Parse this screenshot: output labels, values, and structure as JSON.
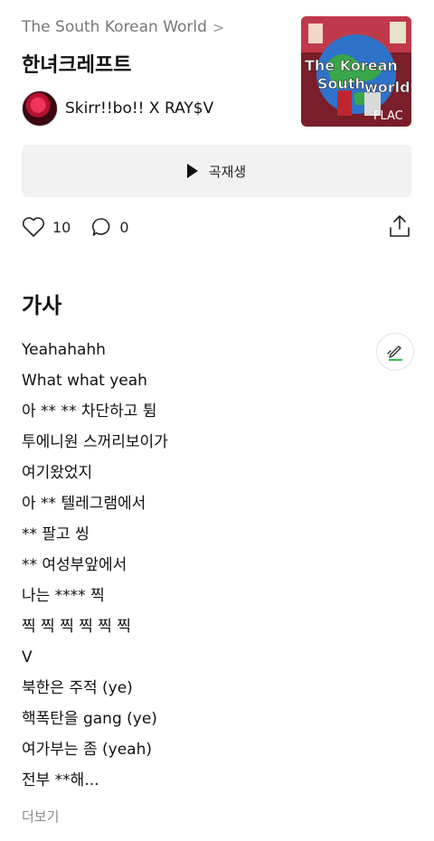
{
  "album": {
    "link_label": "The South Korean World",
    "chevron": ">"
  },
  "song": {
    "title": "한녀크레프트"
  },
  "artist": {
    "name": "Skirr!!bo!! X RAY$V"
  },
  "cover": {
    "title_line1": "The Korean",
    "title_line2": "South",
    "title_line3": "world",
    "badge": "FLAC"
  },
  "player": {
    "play_label": "곡재생"
  },
  "actions": {
    "likes": "10",
    "comments": "0"
  },
  "lyrics": {
    "heading": "가사",
    "lines": [
      "Yeahahahh",
      "What what yeah",
      "아 ** ** 차단하고 튐",
      "투에니원 스꺼리보이가",
      "여기왔었지",
      "아 ** 텔레그램에서",
      "** 팔고 씽",
      "** 여성부앞에서",
      "나는 **** 찍",
      "찍 찍 찍 찍 찍 찍",
      "V",
      "북한은 주적 (ye)",
      "핵폭탄을 gang (ye)",
      "여가부는 좀 (yeah)",
      "전부 **해..."
    ],
    "more_label": "더보기"
  },
  "colors": {
    "accent_green": "#2fbf4a",
    "button_bg": "#f2f2f2",
    "muted_text": "#777777"
  }
}
